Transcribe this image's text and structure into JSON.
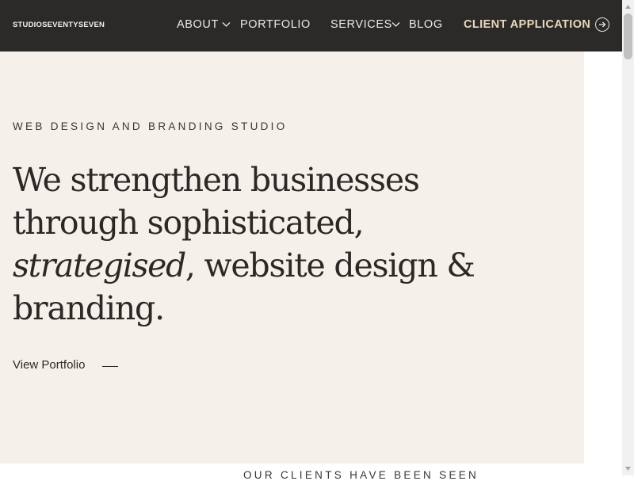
{
  "header": {
    "logo": "STUDIOSEVENTYSEVEN",
    "nav": {
      "about": "ABOUT",
      "portfolio": "PORTFOLIO",
      "services": "SERVICES",
      "blog": "BLOG",
      "client_application": "CLIENT APPLICATION"
    }
  },
  "hero": {
    "eyebrow": "WEB DESIGN AND BRANDING STUDIO",
    "headline_part1": "We strengthen businesses through sophisticated, ",
    "headline_italic": "strategised",
    "headline_part2": ", website design & branding.",
    "link": "View Portfolio"
  },
  "next_section": {
    "heading": "OUR CLIENTS HAVE BEEN SEEN"
  },
  "colors": {
    "header_bg": "#2b2a29",
    "hero_bg": "#f6f0eb",
    "accent": "#e8d9bb",
    "text": "#2b2826"
  },
  "icons": {
    "about_dropdown": "chevron-down-icon",
    "services_dropdown": "chevron-down-icon",
    "cta": "arrow-right-circle-icon"
  }
}
